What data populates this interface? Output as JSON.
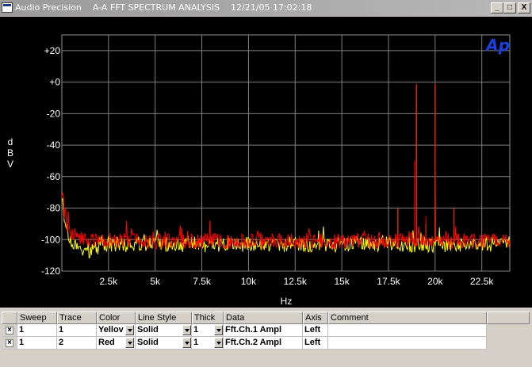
{
  "window": {
    "title": "Audio Precision    A-A FFT SPECTRUM ANALYSIS    12/21/05 17:02:18",
    "minimize_label": "_",
    "maximize_label": "□",
    "close_label": "X"
  },
  "chart_data": {
    "type": "line",
    "title": "",
    "xlabel": "Hz",
    "ylabel": "dBV",
    "ylabel_letters": [
      "d",
      "B",
      "V"
    ],
    "xlim": [
      0,
      24000
    ],
    "ylim": [
      -120,
      30
    ],
    "x_ticks": [
      2500,
      5000,
      7500,
      10000,
      12500,
      15000,
      17500,
      20000,
      22500
    ],
    "x_tick_labels": [
      "2.5k",
      "5k",
      "7.5k",
      "10k",
      "12.5k",
      "15k",
      "17.5k",
      "20k",
      "22.5k"
    ],
    "y_ticks": [
      20,
      0,
      -20,
      -40,
      -60,
      -80,
      -100,
      -120
    ],
    "y_tick_labels": [
      "+20",
      "+0",
      "-20",
      "-40",
      "-60",
      "-80",
      "-100",
      "-120"
    ],
    "grid": true,
    "logo_text": "Ap",
    "series": [
      {
        "name": "Fft.Ch.1 Ampl",
        "color": "#ffff00",
        "noise_floor_db": -103,
        "low_freq_rise": [
          [
            20,
            -70
          ],
          [
            100,
            -82
          ],
          [
            300,
            -95
          ],
          [
            600,
            -104
          ],
          [
            1200,
            -108
          ],
          [
            2000,
            -104
          ]
        ],
        "peaks": [
          [
            19000,
            -2
          ],
          [
            20000,
            -2
          ],
          [
            18000,
            -80
          ],
          [
            19500,
            -90
          ],
          [
            21000,
            -80
          ]
        ]
      },
      {
        "name": "Fft.Ch.2 Ampl",
        "color": "#ff0000",
        "noise_floor_db": -101,
        "low_freq_rise": [
          [
            20,
            -68
          ],
          [
            100,
            -80
          ],
          [
            300,
            -92
          ],
          [
            600,
            -97
          ],
          [
            1200,
            -100
          ],
          [
            2000,
            -101
          ]
        ],
        "peaks": [
          [
            19000,
            -1
          ],
          [
            20000,
            -1
          ],
          [
            18000,
            -80
          ],
          [
            19500,
            -85
          ],
          [
            21000,
            -80
          ],
          [
            18900,
            -50
          ]
        ]
      }
    ]
  },
  "table": {
    "headers": [
      "Sweep",
      "Trace",
      "Color",
      "Line Style",
      "Thick",
      "Data",
      "Axis",
      "Comment"
    ],
    "rows": [
      {
        "checked": "×",
        "sweep": "1",
        "trace": "1",
        "color": "Yellov",
        "line_style": "Solid",
        "thick": "1",
        "data": "Fft.Ch.1 Ampl",
        "axis": "Left",
        "comment": ""
      },
      {
        "checked": "×",
        "sweep": "1",
        "trace": "2",
        "color": "Red",
        "line_style": "Solid",
        "thick": "1",
        "data": "Fft.Ch.2 Ampl",
        "axis": "Left",
        "comment": ""
      }
    ]
  }
}
